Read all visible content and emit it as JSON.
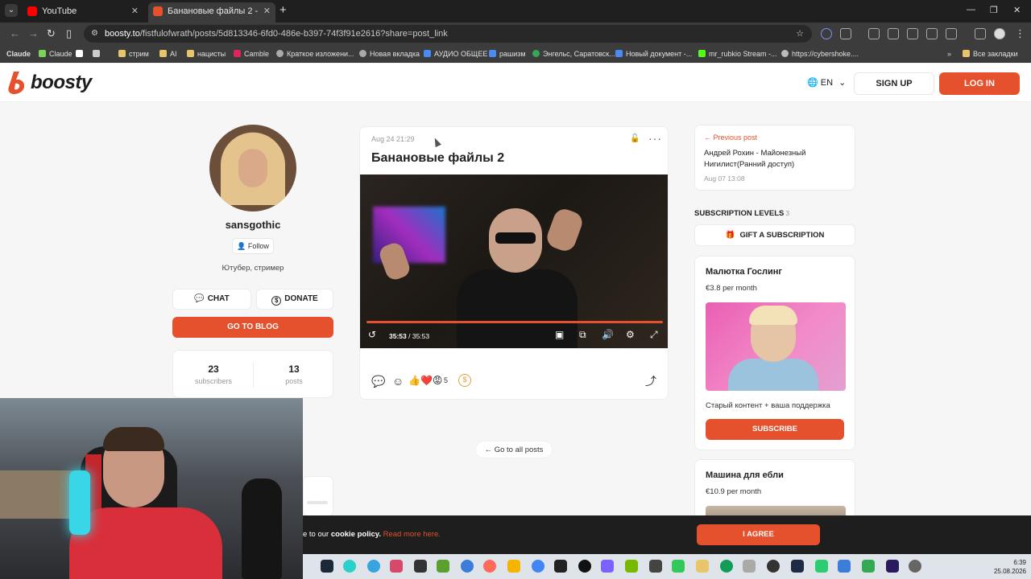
{
  "browser": {
    "tabs": [
      {
        "label": "YouTube",
        "fav_color": "#ff0000"
      },
      {
        "label": "Банановые файлы 2 - sansgothic",
        "fav_color": "#e4512c"
      }
    ],
    "new_tab": "+",
    "url_host": "boosty.to",
    "url_path": "/fistfulofwrath/posts/5d813346-6fd0-486e-b397-74f3f91e2616?share=post_link",
    "bookmarks": [
      {
        "label": "Claude",
        "color": "#d97757"
      },
      {
        "label": "Claude",
        "color": "#7bd35a"
      },
      {
        "label": "",
        "color": "#ffffff"
      },
      {
        "label": "",
        "color": "#cccccc"
      },
      {
        "label": "стрим",
        "color": "#e8c46a"
      },
      {
        "label": "AI",
        "color": "#e8c46a"
      },
      {
        "label": "нацисты",
        "color": "#e8c46a"
      },
      {
        "label": "Camble",
        "color": "#e0245e"
      },
      {
        "label": "Краткое изложени...",
        "color": "#aaaaaa"
      },
      {
        "label": "Новая вкладка",
        "color": "#aaaaaa"
      },
      {
        "label": "АУДИО ОБЩЕЕ",
        "color": "#4a8af4"
      },
      {
        "label": "рашизм",
        "color": "#4a8af4"
      },
      {
        "label": "Энгельс, Саратовск...",
        "color": "#34a853"
      },
      {
        "label": "Новый документ -...",
        "color": "#4a8af4"
      },
      {
        "label": "mr_rubkio Stream -...",
        "color": "#53fc18"
      },
      {
        "label": "https://cybershoke....",
        "color": "#bbbbbb"
      }
    ],
    "all_bookmarks": "Все закладки"
  },
  "site": {
    "logo": "boosty",
    "lang": "EN",
    "signup": "SIGN UP",
    "login": "LOG IN"
  },
  "profile": {
    "name": "sansgothic",
    "follow": "Follow",
    "bio": "Ютубер, стример",
    "chat": "CHAT",
    "donate": "DONATE",
    "go_to_blog": "GO TO BLOG",
    "subscribers_count": "23",
    "subscribers_label": "subscribers",
    "posts_count": "13",
    "posts_label": "posts"
  },
  "post": {
    "date": "Aug 24 21:29",
    "title": "Банановые файлы 2",
    "time_current": "35:53",
    "time_total": "35:53",
    "progress": 1.0,
    "reactions": "👍❤️😡",
    "reaction_count": "5",
    "go_to_all_posts": "Go to all posts"
  },
  "sidebar": {
    "prev_label": "Previous post",
    "prev_title": "Андрей Рохин - Майонезный Нигилист(Ранний доступ)",
    "prev_date": "Aug 07 13:08",
    "subscription_levels": "SUBSCRIPTION LEVELS",
    "subscription_levels_count": "3",
    "gift": "GIFT A SUBSCRIPTION",
    "tiers": [
      {
        "name": "Малютка Гослинг",
        "price": "€3.8 per month",
        "desc": "Старый контент + ваша поддержка",
        "button": "SUBSCRIBE"
      },
      {
        "name": "Машина для ебли",
        "price": "€10.9 per month"
      }
    ]
  },
  "cookie": {
    "text_prefix": "e to our ",
    "text_bold": "cookie policy.",
    "read_more": "Read more here.",
    "agree": "I AGREE"
  },
  "taskbar": {
    "time": "6:39",
    "date": "25.08.2026"
  },
  "colors": {
    "accent": "#e4512c"
  }
}
